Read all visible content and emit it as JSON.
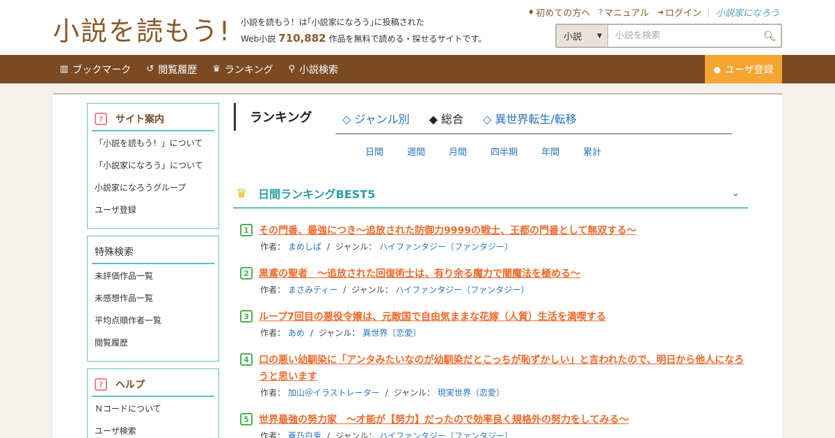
{
  "header": {
    "logo": "小説を読もう!",
    "tagline1": "小説を読もう！は｢小説家になろう｣に投稿された",
    "tagline2_prefix": "Web小説",
    "work_count": "710,882",
    "tagline2_suffix": "作品を無料で読める・探せるサイトです。",
    "links": [
      {
        "icon": "beginner-icon",
        "label": "初めての方へ"
      },
      {
        "icon": "manual-icon",
        "label": "マニュアル"
      },
      {
        "icon": "login-icon",
        "label": "ログイン"
      }
    ],
    "narou_logo": "小説家になろう"
  },
  "search": {
    "category": "小説",
    "placeholder": "小説を検索"
  },
  "nav": {
    "items": [
      {
        "icon": "bookmark-icon",
        "label": "ブックマーク"
      },
      {
        "icon": "history-icon",
        "label": "閲覧履歴"
      },
      {
        "icon": "crown-icon",
        "label": "ランキング"
      },
      {
        "icon": "search-icon",
        "label": "小説検索"
      }
    ],
    "register": "ユーザ登録"
  },
  "sidebar": {
    "site_guide": {
      "title": "サイト案内",
      "items": [
        "「小説を読もう！」について",
        "「小説家になろう」について",
        "小説家になろうグループ",
        "ユーザ登録"
      ]
    },
    "special_search": {
      "title": "特殊検索",
      "items": [
        "未評価作品一覧",
        "未感想作品一覧",
        "平均点順作者一覧",
        "閲覧履歴"
      ]
    },
    "help": {
      "title": "ヘルプ",
      "items": [
        "Ｎコードについて",
        "ユーザ検索"
      ]
    }
  },
  "ranking": {
    "heading": "ランキング",
    "tabs": [
      "◇ ジャンル別",
      "◆ 総合",
      "◇ 異世界転生/転移"
    ],
    "periods": [
      "日間",
      "週間",
      "月間",
      "四半期",
      "年間",
      "累計"
    ],
    "best_title": "日間ランキングBEST5",
    "author_label": "作者：",
    "genre_label": "ジャンル：",
    "entries": [
      {
        "rank": "1",
        "title": "その門番、最強につき～追放された防御力9999の戦士、王都の門番として無双する～",
        "author": "まめしば",
        "genre": "ハイファンタジー〔ファンタジー〕"
      },
      {
        "rank": "2",
        "title": "黒鳶の聖者　～追放された回復術士は、有り余る魔力で闇魔法を極める～",
        "author": "まさみティー",
        "genre": "ハイファンタジー〔ファンタジー〕"
      },
      {
        "rank": "3",
        "title": "ループ7回目の悪役令嬢は、元敵国で自由気ままな花嫁（人質）生活を満喫する",
        "author": "あめ",
        "genre": "異世界〔恋愛〕"
      },
      {
        "rank": "4",
        "title": "口の悪い幼馴染に「アンタみたいなのが幼馴染だとこっちが恥ずかしい」と言われたので、明日から他人になろうと思います",
        "author": "加山＠イラストレーター",
        "genre": "現実世界〔恋愛〕"
      },
      {
        "rank": "5",
        "title": "世界最強の努力家　～才能が【努力】だったので効率良く規格外の努力をしてみる～",
        "author": "蒼乃白兎",
        "genre": "ハイファンタジー〔ファンタジー〕"
      }
    ]
  },
  "colors": {
    "brand_brown": "#7b4a23",
    "accent_orange": "#f4a532",
    "title_orange": "#f06a2c",
    "teal": "#5fbfc2",
    "link_blue": "#2a73c0"
  }
}
